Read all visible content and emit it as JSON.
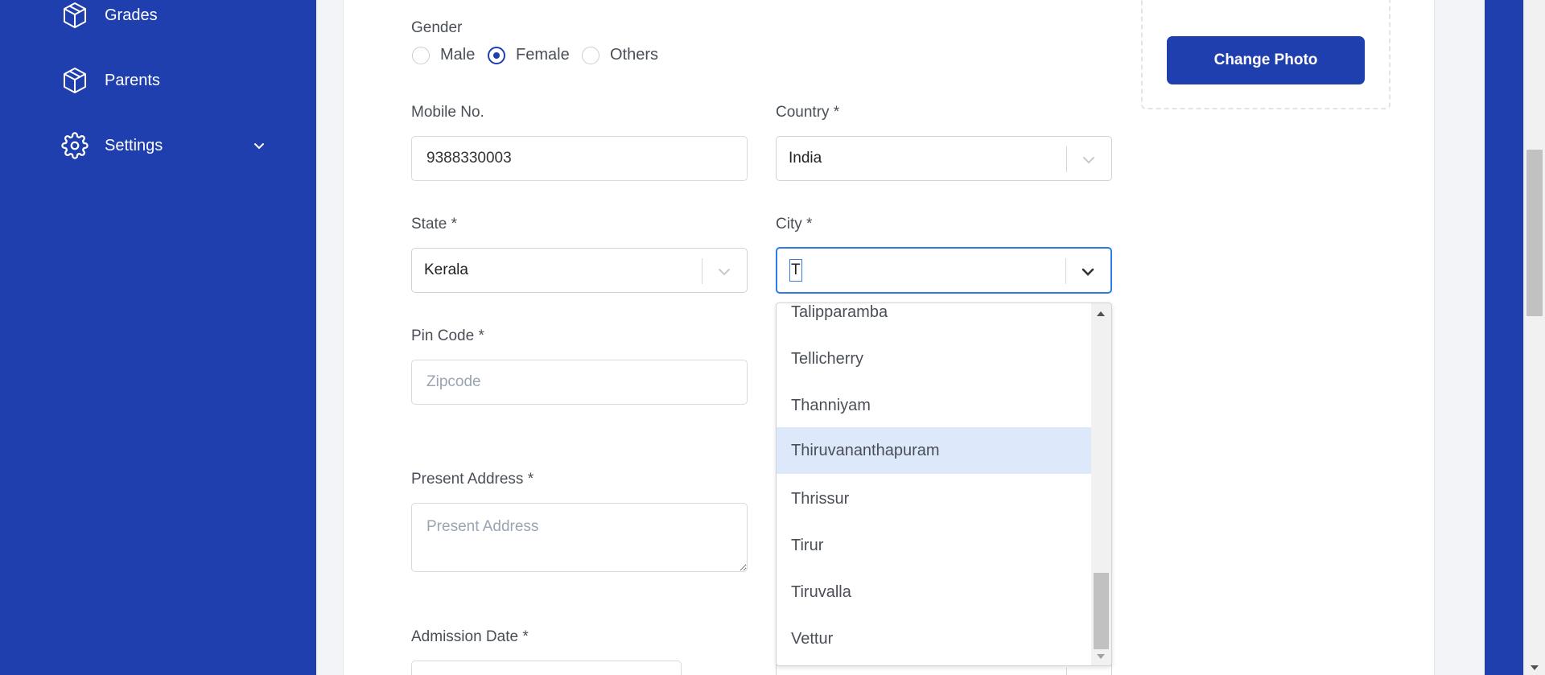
{
  "sidebar": {
    "items": [
      {
        "label": "Grades",
        "icon": "cube-icon"
      },
      {
        "label": "Parents",
        "icon": "cube-icon"
      },
      {
        "label": "Settings",
        "icon": "gear-icon"
      }
    ]
  },
  "form": {
    "gender": {
      "label": "Gender",
      "options": [
        "Male",
        "Female",
        "Others"
      ],
      "selected": "Female"
    },
    "mobile": {
      "label": "Mobile No.",
      "value": "9388330003"
    },
    "country": {
      "label": "Country *",
      "value": "India"
    },
    "state": {
      "label": "State *",
      "value": "Kerala"
    },
    "city": {
      "label": "City *",
      "value": "T",
      "options": [
        "Talipparamba",
        "Tellicherry",
        "Thanniyam",
        "Thiruvananthapuram",
        "Thrissur",
        "Tirur",
        "Tiruvalla",
        "Vettur"
      ],
      "highlighted": "Thiruvananthapuram"
    },
    "pincode": {
      "label": "Pin Code *",
      "placeholder": "Zipcode"
    },
    "present_address": {
      "label": "Present Address *",
      "placeholder": "Present Address"
    },
    "admission_date": {
      "label": "Admission Date *"
    }
  },
  "photo": {
    "button_label": "Change Photo"
  },
  "colors": {
    "brand": "#1f3fae",
    "focus": "#2d7be5",
    "highlight": "#dde9fb"
  }
}
